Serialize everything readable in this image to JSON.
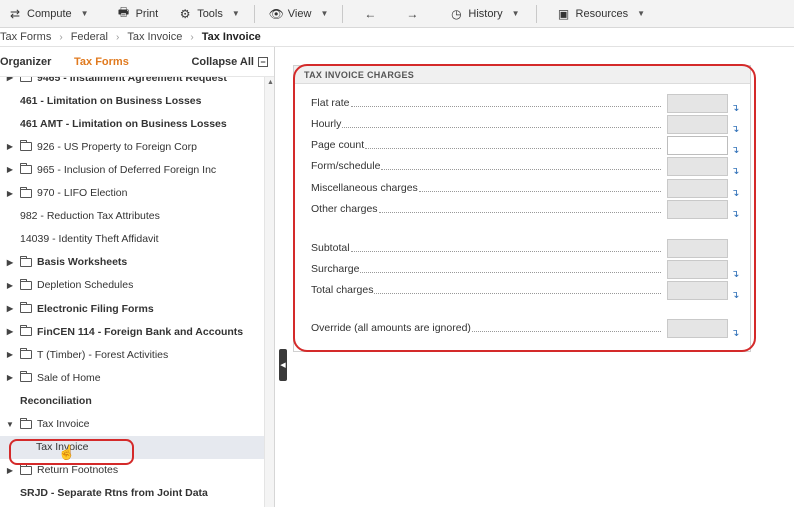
{
  "toolbar": {
    "compute": "Compute",
    "print": "Print",
    "tools": "Tools",
    "view": "View",
    "history": "History",
    "resources": "Resources"
  },
  "breadcrumb": [
    "Tax Forms",
    "Federal",
    "Tax Invoice",
    "Tax Invoice"
  ],
  "left_panel": {
    "tab_organizer": "Organizer",
    "tab_taxforms": "Tax Forms",
    "collapse_all": "Collapse All",
    "tree": [
      {
        "label": "9465 - Installment Agreement Request",
        "bold": true,
        "expander": "right",
        "folder": true
      },
      {
        "label": "461 - Limitation on Business Losses",
        "bold": true,
        "expander": "",
        "folder": false
      },
      {
        "label": "461 AMT - Limitation on Business Losses",
        "bold": true,
        "expander": "",
        "folder": false
      },
      {
        "label": "926 - US Property to Foreign Corp",
        "bold": false,
        "expander": "right",
        "folder": true
      },
      {
        "label": "965 - Inclusion of Deferred Foreign Inc",
        "bold": false,
        "expander": "right",
        "folder": true
      },
      {
        "label": "970 - LIFO Election",
        "bold": false,
        "expander": "right",
        "folder": true
      },
      {
        "label": "982 - Reduction Tax Attributes",
        "bold": false,
        "expander": "",
        "folder": false
      },
      {
        "label": "14039 - Identity Theft Affidavit",
        "bold": false,
        "expander": "",
        "folder": false
      },
      {
        "label": "Basis Worksheets",
        "bold": true,
        "expander": "right",
        "folder": true
      },
      {
        "label": "Depletion Schedules",
        "bold": false,
        "expander": "right",
        "folder": true
      },
      {
        "label": "Electronic Filing Forms",
        "bold": true,
        "expander": "right",
        "folder": true
      },
      {
        "label": "FinCEN 114 - Foreign Bank and Accounts",
        "bold": true,
        "expander": "right",
        "folder": true
      },
      {
        "label": "T (Timber) - Forest Activities",
        "bold": false,
        "expander": "right",
        "folder": true
      },
      {
        "label": "Sale of Home",
        "bold": false,
        "expander": "right",
        "folder": true
      },
      {
        "label": "Reconciliation",
        "bold": true,
        "expander": "",
        "folder": false
      },
      {
        "label": "Tax Invoice",
        "bold": false,
        "expander": "down",
        "folder": true
      },
      {
        "label": "Tax Invoice",
        "bold": false,
        "expander": "",
        "folder": false,
        "child": true,
        "selected": true
      },
      {
        "label": "Return Footnotes",
        "bold": false,
        "expander": "right",
        "folder": true
      },
      {
        "label": "SRJD - Separate Rtns from Joint Data",
        "bold": true,
        "expander": "",
        "folder": false
      }
    ]
  },
  "form": {
    "title": "TAX INVOICE CHARGES",
    "rows": [
      {
        "label": "Flat rate",
        "value": "",
        "editable": false,
        "link": true
      },
      {
        "label": "Hourly",
        "value": "",
        "editable": false,
        "link": true
      },
      {
        "label": "Page count",
        "value": "",
        "editable": true,
        "link": true
      },
      {
        "label": "Form/schedule",
        "value": "",
        "editable": false,
        "link": true
      },
      {
        "label": "Miscellaneous charges",
        "value": "",
        "editable": false,
        "link": true
      },
      {
        "label": "Other charges",
        "value": "",
        "editable": false,
        "link": true
      },
      {
        "label": "Subtotal",
        "value": "",
        "editable": false,
        "link": false
      },
      {
        "label": "Surcharge",
        "value": "",
        "editable": false,
        "link": true
      },
      {
        "label": "Total charges",
        "value": "",
        "editable": false,
        "link": true
      },
      {
        "label": "Override (all amounts are ignored)",
        "value": "",
        "editable": false,
        "link": true
      }
    ]
  },
  "colors": {
    "accent_orange": "#e07a1f",
    "annotation_red": "#d42a2a",
    "link_blue": "#2e6fb7"
  }
}
